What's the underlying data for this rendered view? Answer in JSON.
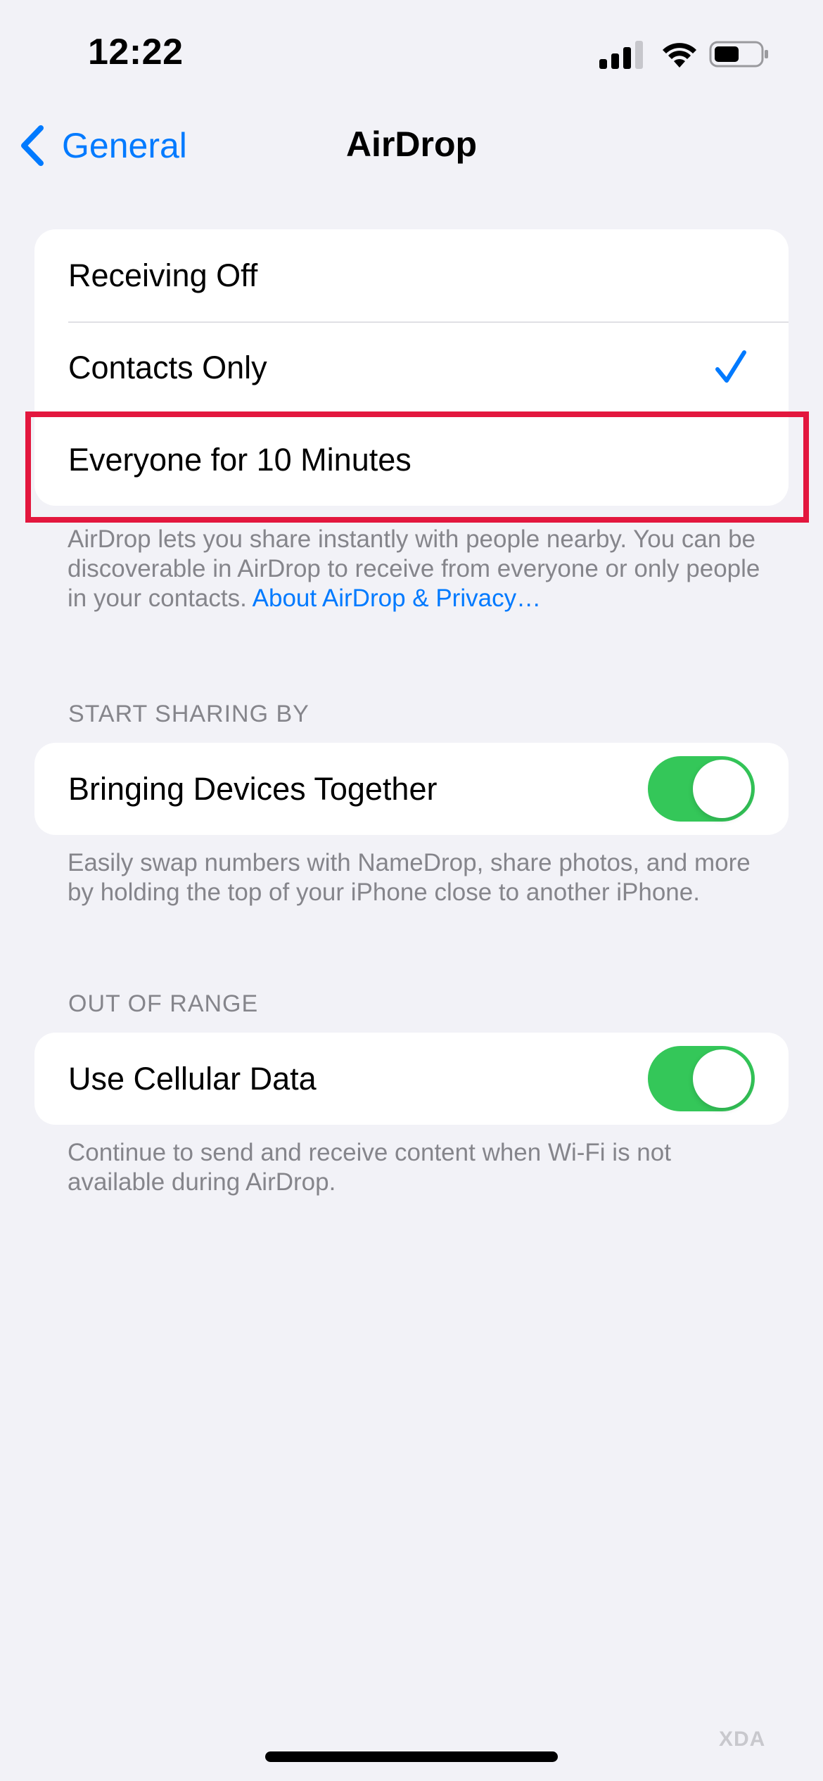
{
  "status_bar": {
    "time": "12:22"
  },
  "nav": {
    "back_label": "General",
    "title": "AirDrop"
  },
  "receiving": {
    "options": [
      {
        "label": "Receiving Off",
        "selected": false
      },
      {
        "label": "Contacts Only",
        "selected": true
      },
      {
        "label": "Everyone for 10 Minutes",
        "selected": false
      }
    ],
    "footer_text": "AirDrop lets you share instantly with people nearby. You can be discoverable in AirDrop to receive from everyone or only people in your contacts.",
    "footer_link": "About AirDrop & Privacy…"
  },
  "start_sharing": {
    "header": "START SHARING BY",
    "label": "Bringing Devices Together",
    "enabled": true,
    "footer_text": "Easily swap numbers with NameDrop, share photos, and more by holding the top of your iPhone close to another iPhone."
  },
  "out_of_range": {
    "header": "OUT OF RANGE",
    "label": "Use Cellular Data",
    "enabled": true,
    "footer_text": "Continue to send and receive content when Wi-Fi is not available during AirDrop."
  },
  "watermark": "XDA",
  "colors": {
    "accent": "#007aff",
    "toggle_on": "#34c759",
    "highlight": "#e3173e",
    "background": "#f2f2f7"
  }
}
